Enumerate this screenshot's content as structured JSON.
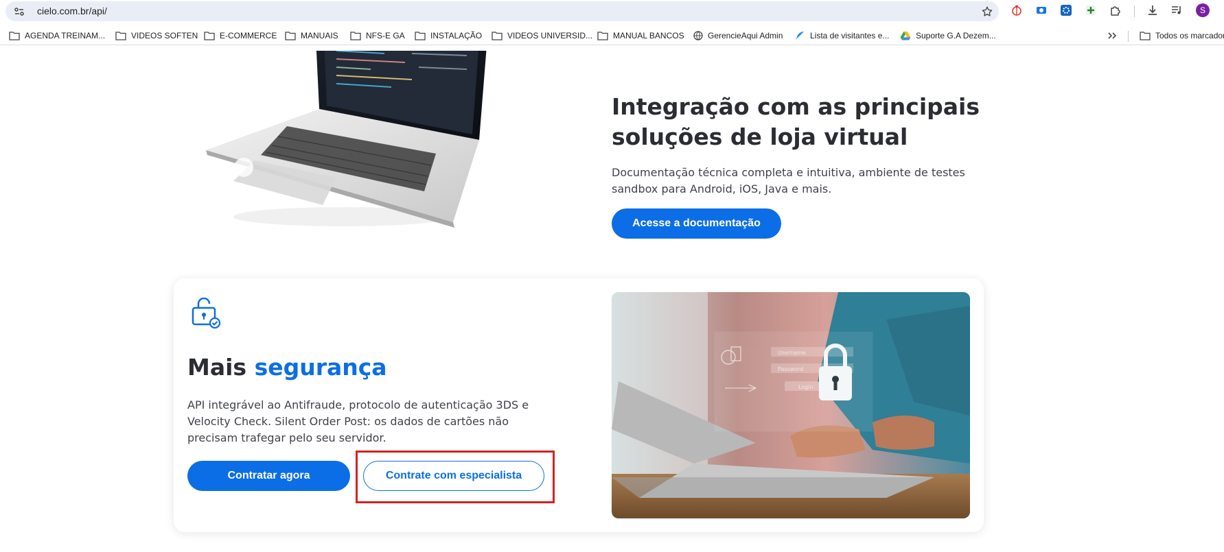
{
  "browser": {
    "url": "cielo.com.br/api/",
    "profile_initial": "S",
    "colors": {
      "omnibox_bg": "#e9eef6",
      "profile": "#7b1fa2"
    }
  },
  "bookmarks": [
    {
      "label": "AGENDA TREINAM...",
      "icon": "folder-icon"
    },
    {
      "label": "VIDEOS SOFTEN",
      "icon": "folder-icon"
    },
    {
      "label": "E-COMMERCE",
      "icon": "folder-icon"
    },
    {
      "label": "MANUAIS",
      "icon": "folder-icon"
    },
    {
      "label": "NFS-E GA",
      "icon": "folder-icon"
    },
    {
      "label": "INSTALAÇÃO",
      "icon": "folder-icon"
    },
    {
      "label": "VIDEOS UNIVERSID...",
      "icon": "folder-icon"
    },
    {
      "label": "MANUAL BANCOS",
      "icon": "folder-icon"
    },
    {
      "label": "GerencieAqui Admin",
      "icon": "globe-icon"
    },
    {
      "label": "Lista de visitantes e...",
      "icon": "feather-icon"
    },
    {
      "label": "Suporte G.A Dezem...",
      "icon": "drive-icon"
    }
  ],
  "bookmarks_all": {
    "label": "Todos os marcadores",
    "icon": "folder-icon"
  },
  "integration": {
    "title": "Integração com as principais soluções de loja virtual",
    "description": "Documentação técnica completa e intuitiva, ambiente de testes sandbox para Android, iOS, Java e mais.",
    "button_label": "Acesse a documentação"
  },
  "security": {
    "title_prefix": "Mais",
    "title_accent": "segurança",
    "description": "API integrável ao Antifraude, protocolo de autenticação 3DS e Velocity Check. Silent Order Post: os dados de cartões não precisam trafegar pelo seu servidor.",
    "primary_button": "Contratar agora",
    "secondary_button": "Contrate com especialista",
    "image_labels": {
      "username": "Username",
      "password": "Password",
      "login": "Login"
    }
  },
  "colors": {
    "accent": "#0c6ee6",
    "heading": "#2b2d33",
    "highlight": "#d32222"
  }
}
